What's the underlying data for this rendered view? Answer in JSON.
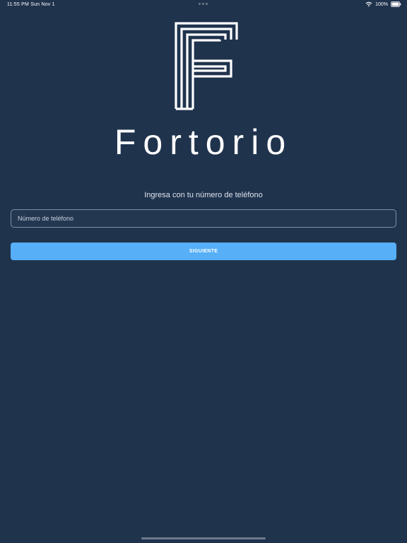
{
  "status_bar": {
    "time": "11:55 PM",
    "date": "Sun Nov 1",
    "battery": "100%",
    "wifi_icon": "wifi-icon",
    "battery_icon": "battery-icon"
  },
  "brand": {
    "logo_icon": "fortorio-logo-icon",
    "name": "Fortorio"
  },
  "login": {
    "subtitle": "Ingresa con tu número de teléfono",
    "phone_placeholder": "Número de teléfono",
    "phone_value": "",
    "next_label": "SIGUIENTE"
  },
  "colors": {
    "background": "#20334d",
    "button": "#56aff7"
  }
}
